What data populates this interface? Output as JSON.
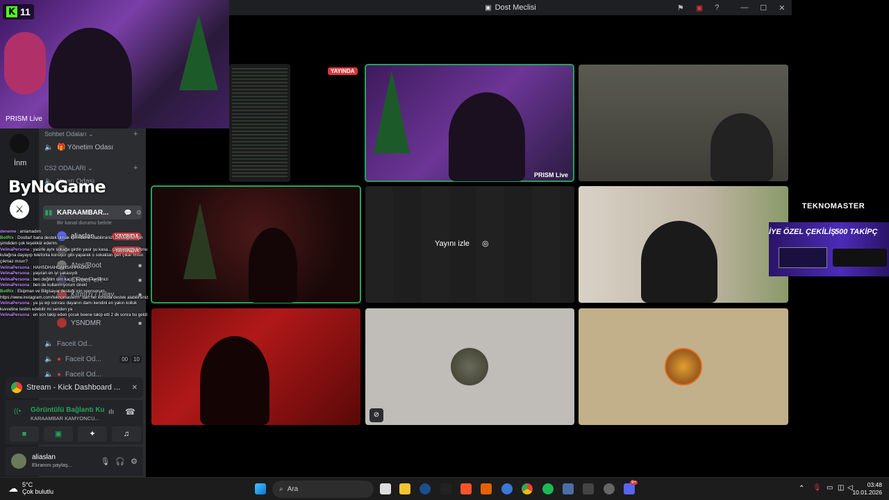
{
  "window": {
    "title": "Dost Meclisi"
  },
  "overlay": {
    "kick_count": "11",
    "prism_label": "PRISM Live",
    "bynogame": "ByNoGame"
  },
  "server_rail": {
    "label": "İnm"
  },
  "channels": {
    "cat1": "Sohbet Odaları",
    "yonetim": "🎁 Yönetim Odası",
    "cat2": "CS2 ODALARI",
    "yayin": "Yayın Odası",
    "active_voice": "KARAAMBAR...",
    "voice_status": "Bir kanal durumu belirle",
    "users": [
      {
        "name": "aliaslan",
        "live": "YAYINDA"
      },
      {
        "name": "",
        "live": "YAYINDA"
      },
      {
        "name": "Ateş/Root",
        "live": ""
      },
      {
        "name": "CReePeR",
        "live": ""
      },
      {
        "name": "Kırmızı / Dilay",
        "live": ""
      },
      {
        "name": "YSNDMR",
        "live": ""
      }
    ],
    "faceit1": "Faceit Od...",
    "faceit2": "Faceit Od...",
    "faceit3": "Faceit Od...",
    "faceit_counts": [
      "00",
      "10"
    ]
  },
  "chat_lines": [
    {
      "user": "deneme",
      "text": " : anlamadım"
    },
    {
      "user": "BotRix",
      "text": " : Dostlar! bana destek olmak için Abone olabilirsiniz! Desteğiniz için şimdiden çok teşekkür ederim."
    },
    {
      "user": "VelinaPersona",
      "text": " : yasirle aynı sokağa girdin yasir şu kasa... çalmayan telefonu kulağına dayayıp telefonla konuşur gibi yaparak o sokaktan geri çıkar mısın çıkmaz mısın?"
    },
    {
      "user": "VelinaPersona",
      "text": " : HAHSDHAHDAHSAHHADSA"
    },
    {
      "user": "VelinaPersona",
      "text": " : yaşıran en iyi şakasıydı"
    },
    {
      "user": "VelinaPersona",
      "text": " : ben değilim olm kaçın kurtarın kendinizi"
    },
    {
      "user": "VelinaPersona",
      "text": " : ben de kullanmıyorum direkt"
    },
    {
      "user": "BotRix",
      "text": " : Ekipman ve Bilgisayar desteği için sponsorum https://www.instagram.com/teknomasterrr/ 'dan her konuda destek alabilirsiniz."
    },
    {
      "user": "VelinaPersona",
      "text": " : ya şu wp sonrası dayanın damı kendini en yakın kolluk kuvvetine teslim edebilir mi seriden ya"
    },
    {
      "user": "VelinaPersona",
      "text": " : en son takip eden çocuk beene takip etti 2 dk sonra bu geldi"
    }
  ],
  "stream_card": {
    "title": "Stream - Kick Dashboard ..."
  },
  "connection": {
    "status": "Görüntülü Bağlantı Ku",
    "channel": "KARAAMBAR KAMYONCU..."
  },
  "user_panel": {
    "name": "aliaslan",
    "status": "Ekranını paylaş..."
  },
  "tiles": {
    "live_tag": "YAYINDA",
    "watch_label": "Yayını izle",
    "prism_label": "PRISM Live"
  },
  "promo": {
    "brand": "TEKNOMASTER",
    "left_text": "İYE ÖZEL ÇEKİLİŞ",
    "right_text": "500 TAKİPÇ"
  },
  "taskbar": {
    "temp": "5°C",
    "weather": "Çok bulutlu",
    "search_placeholder": "Ara",
    "time": "03:48",
    "date": "10.01.2026",
    "discord_badge": "9+"
  },
  "colors": {
    "discord_bg": "#2b2d31",
    "live_red": "#da373c",
    "speaking_green": "#23a55a",
    "kick_green": "#53fc18"
  }
}
